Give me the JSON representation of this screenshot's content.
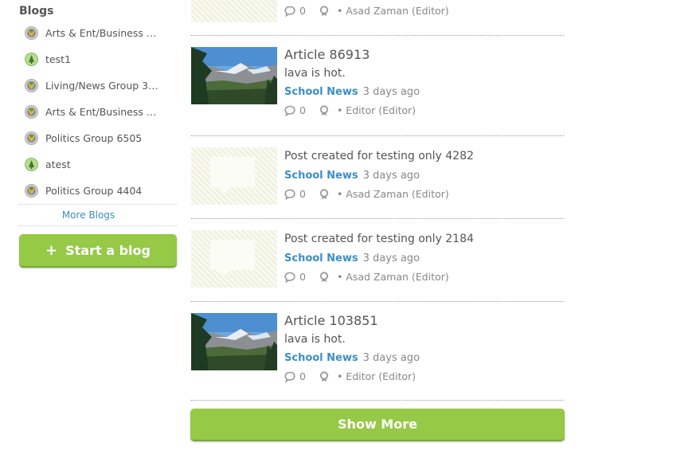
{
  "sidebar": {
    "title": "Blogs",
    "items": [
      {
        "label": "Arts & Ent/Business …",
        "icon": "group-badge-icon"
      },
      {
        "label": "test1",
        "icon": "tree-badge-icon"
      },
      {
        "label": "Living/News Group 3…",
        "icon": "group-badge-icon"
      },
      {
        "label": "Arts & Ent/Business …",
        "icon": "group-badge-icon"
      },
      {
        "label": "Politics Group 6505",
        "icon": "group-badge-icon"
      },
      {
        "label": "atest",
        "icon": "tree-badge-icon"
      },
      {
        "label": "Politics Group 4404",
        "icon": "group-badge-icon"
      }
    ],
    "more_label": "More Blogs",
    "start_label": "Start a blog",
    "start_plus": "+"
  },
  "feed": {
    "top_partial": {
      "comments": "0",
      "author": "• Asad Zaman (Editor)"
    },
    "posts": [
      {
        "title": "Article 86913",
        "excerpt": "lava is hot.",
        "category": "School News",
        "time": "3 days ago",
        "comments": "0",
        "author": "• Editor (Editor)",
        "thumb": "photo"
      },
      {
        "title": "Post created for testing only 4282",
        "category": "School News",
        "time": "3 days ago",
        "comments": "0",
        "author": "• Asad Zaman (Editor)",
        "thumb": "placeholder"
      },
      {
        "title": "Post created for testing only 2184",
        "category": "School News",
        "time": "3 days ago",
        "comments": "0",
        "author": "• Asad Zaman (Editor)",
        "thumb": "placeholder"
      },
      {
        "title": "Article 103851",
        "excerpt": "lava is hot.",
        "category": "School News",
        "time": "3 days ago",
        "comments": "0",
        "author": "• Editor (Editor)",
        "thumb": "photo"
      }
    ],
    "show_more_label": "Show More"
  },
  "colors": {
    "accent_green": "#95c946",
    "link_blue": "#3a8fc7"
  }
}
